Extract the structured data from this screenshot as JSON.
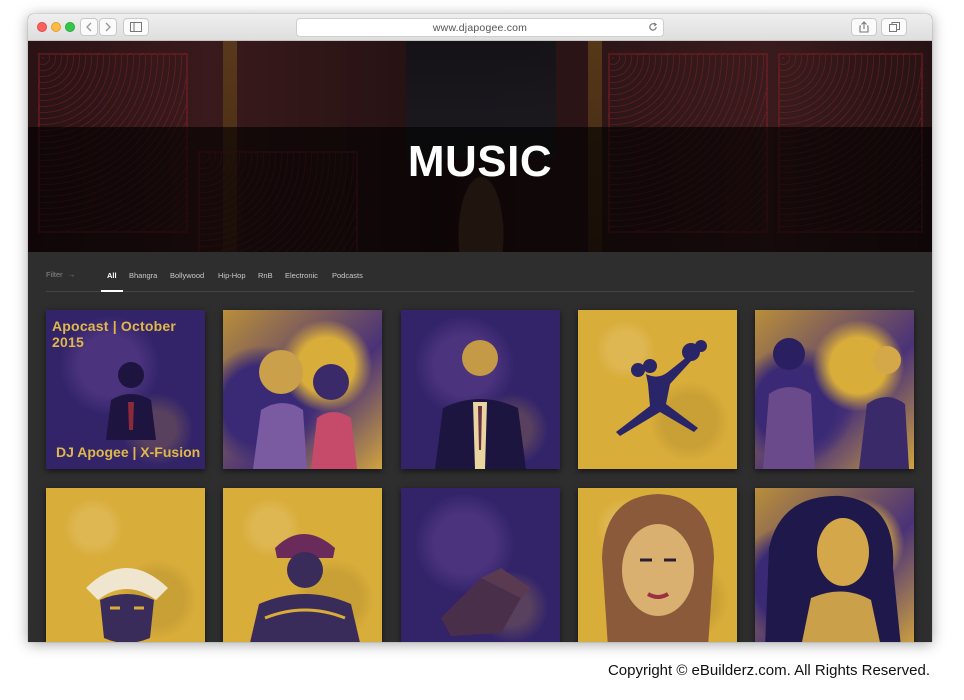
{
  "browser": {
    "url": "www.djapogee.com"
  },
  "hero": {
    "title": "MUSIC"
  },
  "filter": {
    "label": "Filter",
    "arrow": "→",
    "items": [
      {
        "label": "All",
        "active": true
      },
      {
        "label": "Bhangra",
        "active": false
      },
      {
        "label": "Bollywood",
        "active": false
      },
      {
        "label": "Hip-Hop",
        "active": false
      },
      {
        "label": "RnB",
        "active": false
      },
      {
        "label": "Electronic",
        "active": false
      },
      {
        "label": "Podcasts",
        "active": false
      }
    ]
  },
  "grid": {
    "covers": [
      {
        "title": "Apocast | October 2015",
        "subtitle": "DJ Apogee | X-Fusion"
      }
    ]
  },
  "copyright": "Copyright © eBuilderz.com. All Rights Reserved.",
  "colors": {
    "accent_yellow": "#d9ad3a",
    "accent_purple": "#33246a",
    "page_dark": "#2e2e2e"
  }
}
